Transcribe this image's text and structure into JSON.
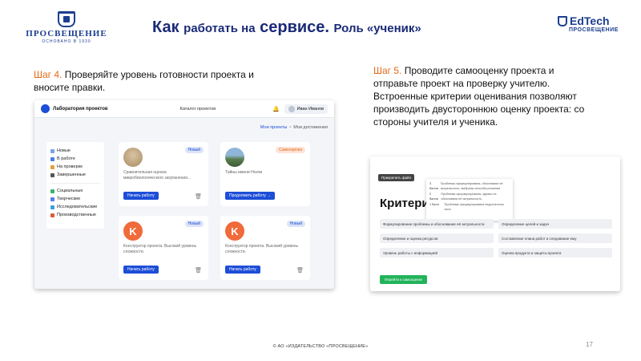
{
  "logos": {
    "left_name": "ПРОСВЕЩЕНИЕ",
    "left_since": "ОСНОВАНО В 1930",
    "right_main": "EdTech",
    "right_sub": "ПРОСВЕЩЕНИЕ"
  },
  "title": {
    "part1": "Как",
    "part2": "работать на",
    "part3": "сервисе.",
    "part4": "Роль «ученик»"
  },
  "step4": {
    "label": "Шаг 4.",
    "text": "Проверяйте уровень готовности проекта и вносите правки."
  },
  "step5": {
    "label": "Шаг 5.",
    "text": "Проводите самооценку проекта и отправьте проект на проверку учителю. Встроенные критерии оценивания позволяют производить двустороннюю оценку проекта: со стороны учителя и ученика."
  },
  "screen1": {
    "brand": "Лаборатория проектов",
    "catalog": "Каталог проектов",
    "user": "Иван Иванов",
    "tab_active": "Мои проекты",
    "tab_other": "Мои достижения",
    "sidebar": [
      "Новые",
      "В работе",
      "На проверке",
      "Завершенные",
      "Социальные",
      "Творческие",
      "Исследовательские",
      "Производственные"
    ],
    "cards": [
      {
        "badge": "Новый",
        "text": "Сравнительная оценка микробиологического загрязнения...",
        "button": "Начать работу"
      },
      {
        "badge": "Самооценка",
        "text": "Тайны имени Нохчи",
        "button": "Продолжить работу →"
      },
      {
        "badge": "Новый",
        "text": "Конструктор проекта. Высокий уровень сложности.",
        "button": "Начать работу"
      },
      {
        "badge": "Новый",
        "text": "Конструктор проекта. Высокий уровень сложности.",
        "button": "Начать работу"
      }
    ]
  },
  "screen2": {
    "top_button": "Прикрепить файл",
    "heading": "Критери",
    "popup": [
      {
        "k": "3 балла",
        "v": "Проблема сформулирована, обоснована её актуальность, выбраны способы решения"
      },
      {
        "k": "2 балла",
        "v": "Проблема сформулирована, однако не обоснована её актуальность"
      },
      {
        "k": "1 балл",
        "v": "Проблема сформулирована недостаточно ясно"
      }
    ],
    "rows_left": [
      "Формулирование проблемы и обоснование её актуальности",
      "Определение и оценка ресурсов",
      "Уровень работы с информацией"
    ],
    "rows_right": [
      "Определение целей и задач",
      "Составление плана работ и следование ему",
      "Оценка продукта и защиты проекта"
    ],
    "submit": "Перейти к самооценке"
  },
  "footer": "© АО «ИЗДАТЕЛЬСТВО «ПРОСВЕЩЕНИЕ»",
  "page_number": "17"
}
